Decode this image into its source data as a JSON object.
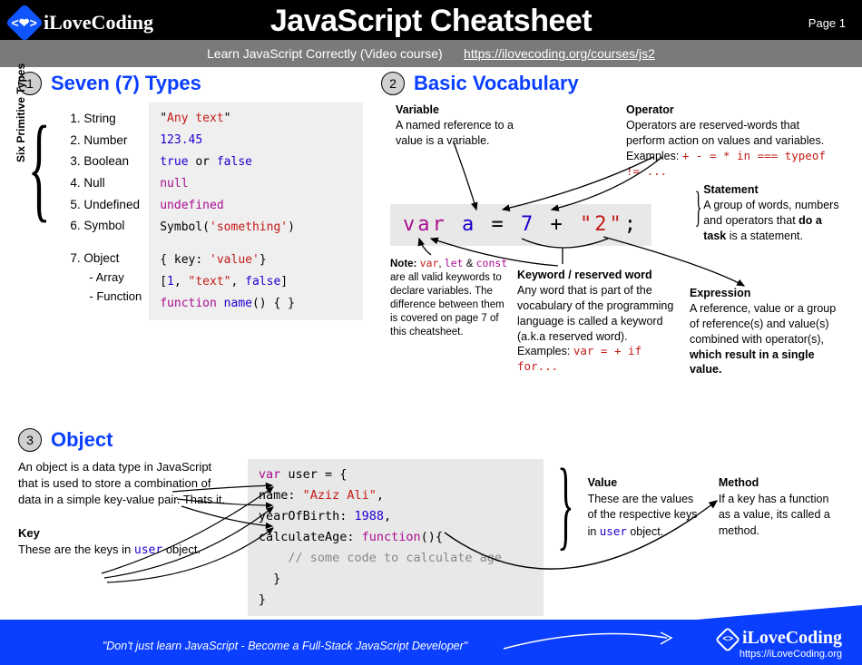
{
  "header": {
    "brand": "iLoveCoding",
    "title": "JavaScript Cheatsheet",
    "page": "Page 1",
    "subtitle_lead": "Learn JavaScript Correctly (Video course)",
    "subtitle_url": "https://ilovecoding.org/courses/js2"
  },
  "section1": {
    "num": "1",
    "title": "Seven (7) Types",
    "side_label": "Six Primitive Types",
    "types": {
      "t1": "String",
      "t2": "Number",
      "t3": "Boolean",
      "t4": "Null",
      "t5": "Undefined",
      "t6": "Symbol",
      "t7": "Object",
      "t7a": "- Array",
      "t7b": "- Function"
    },
    "code": {
      "c1a": "\"",
      "c1b": "Any text",
      "c1c": "\"",
      "c2": "123.45",
      "c3a": "true",
      "c3b": " or ",
      "c3c": "false",
      "c4": "null",
      "c5": "undefined",
      "c6a": "Symbol(",
      "c6b": "'something'",
      "c6c": ")",
      "c7a": "{ key: ",
      "c7b": "'value'",
      "c7c": "}",
      "c8a": "[",
      "c8b": "1",
      "c8c": ", ",
      "c8d": "\"text\"",
      "c8e": ", ",
      "c8f": "false",
      "c8g": "]",
      "c9a": "function",
      "c9b": " name",
      "c9c": "() { }"
    }
  },
  "section2": {
    "num": "2",
    "title": "Basic Vocabulary",
    "variable": {
      "term": "Variable",
      "def": "A named reference to a value is a variable."
    },
    "operator": {
      "term": "Operator",
      "def": "Operators are reserved-words that perform action on values and variables.",
      "ex_label": "Examples: ",
      "ex": "+ - = * in === typeof != ..."
    },
    "code": {
      "kvar": "var ",
      "kname": "a",
      "keq": " = ",
      "knum": "7",
      "kplus": " + ",
      "kstr": "\"2\"",
      "ksemi": ";"
    },
    "statement": {
      "term": "Statement",
      "def_a": "A group of words, numbers and operators that ",
      "def_b": "do a task",
      "def_c": " is a statement."
    },
    "note": {
      "label": "Note: ",
      "k1": "var",
      "k2": "let",
      "k3": "const",
      "sep1": ", ",
      "sep2": " & ",
      "rest": " are all valid keywords to declare variables. The difference between them is covered on page 7 of this cheatsheet."
    },
    "keyword": {
      "term": "Keyword / reserved word",
      "def": "Any word that is part of the vocabulary of the programming language is called a keyword (a.k.a reserved word).",
      "ex_label": "Examples: ",
      "ex": "var = + if for..."
    },
    "expression": {
      "term": "Expression",
      "def_a": "A reference, value or a group of reference(s) and value(s) combined with operator(s), ",
      "def_b": "which result in a single value."
    }
  },
  "section3": {
    "num": "3",
    "title": "Object",
    "intro": "An object is a data type in JavaScript that is used to store a combination of data in a simple key-value pair. Thats it.",
    "key": {
      "term": "Key",
      "def_a": "These are the keys in ",
      "def_b": "user",
      "def_c": " object."
    },
    "code": {
      "l1a": "var",
      "l1b": " user = {",
      "l2a": "  name: ",
      "l2b": "\"Aziz Ali\"",
      "l2c": ",",
      "l3a": "  yearOfBirth: ",
      "l3b": "1988",
      "l3c": ",",
      "l4a": "  calculateAge: ",
      "l4b": "function",
      "l4c": "(){",
      "l5": "    // some code to calculate age",
      "l6": "  }",
      "l7": "}"
    },
    "value": {
      "term": "Value",
      "def_a": "These are the values of the respective keys in ",
      "def_b": "user",
      "def_c": " object."
    },
    "method": {
      "term": "Method",
      "def": "If a key has a function as a value, its called a method."
    }
  },
  "footer": {
    "quote": "\"Don't just learn JavaScript - Become a Full-Stack JavaScript Developer\"",
    "brand": "iLoveCoding",
    "url": "https://iLoveCoding.org"
  }
}
